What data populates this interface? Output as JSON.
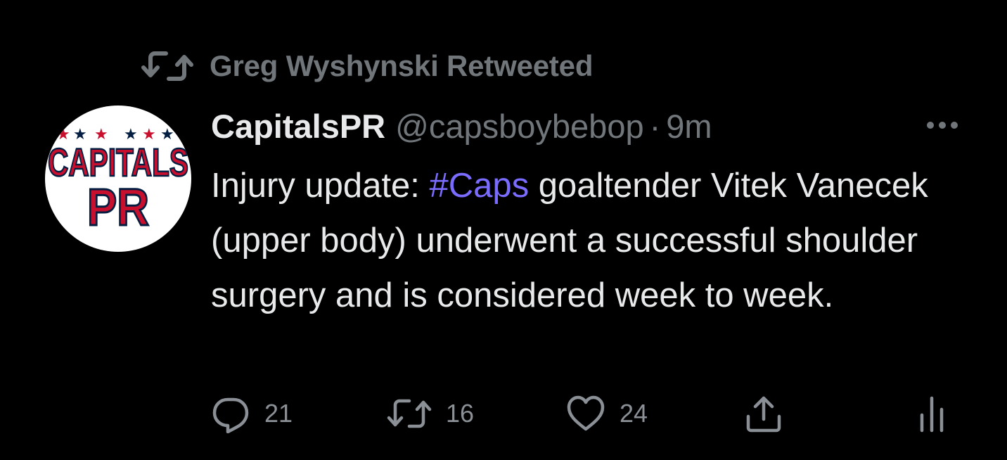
{
  "social_context": {
    "text": "Greg Wyshynski Retweeted",
    "icon": "retweet-icon"
  },
  "author": {
    "display_name": "CapitalsPR",
    "handle": "@capsboybebop",
    "separator": "·",
    "timestamp": "9m",
    "avatar": {
      "icon": "capitals-pr-logo",
      "line1": "CAPITALS",
      "line2": "PR",
      "colors": {
        "text": "#c8102e",
        "stars_blue": "#041e42",
        "stars_red": "#c8102e",
        "outline": "#041e42",
        "background": "#ffffff"
      }
    }
  },
  "tweet": {
    "text_before": "Injury update: ",
    "hashtag": "#Caps",
    "text_after": " goaltender Vitek Vanecek (upper body) underwent a successful shoulder surgery and is considered week to week."
  },
  "actions": {
    "reply": {
      "icon": "reply-icon",
      "count": "21"
    },
    "retweet": {
      "icon": "retweet-icon",
      "count": "16"
    },
    "like": {
      "icon": "heart-icon",
      "count": "24"
    },
    "share": {
      "icon": "share-icon"
    },
    "analytics": {
      "icon": "analytics-icon"
    }
  },
  "more_menu": {
    "icon": "more-horizontal-icon"
  },
  "colors": {
    "background": "#000000",
    "primary_text": "#e7e9ea",
    "secondary_text": "#71767b",
    "hashtag": "#7a6cff"
  }
}
